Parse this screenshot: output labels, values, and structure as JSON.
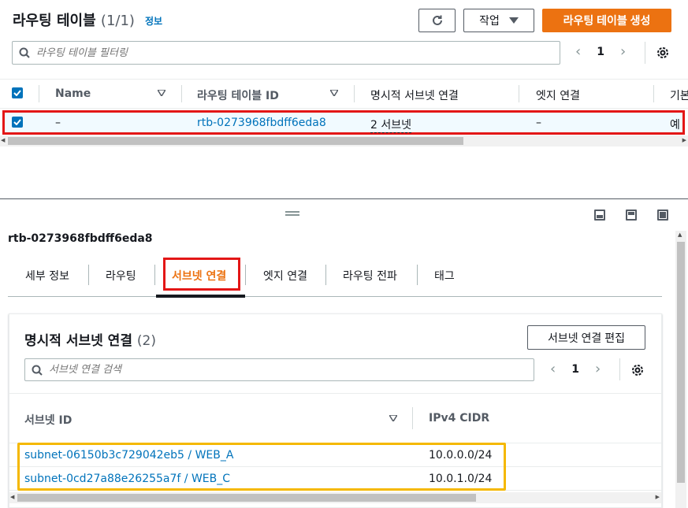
{
  "header": {
    "title": "라우팅 테이블",
    "count": "(1/1)",
    "info_link": "정보",
    "actions_label": "작업",
    "create_label": "라우팅 테이블 생성",
    "filter_placeholder": "라우팅 테이블 필터링",
    "page": "1"
  },
  "route_table": {
    "columns": [
      "Name",
      "라우팅 테이블 ID",
      "명시적 서브넷 연결",
      "엣지 연결",
      "기본"
    ],
    "row": {
      "name": "–",
      "id": "rtb-0273968fbdff6eda8",
      "explicit_subnets": "2 서브넷",
      "edge": "–",
      "main": "예"
    }
  },
  "details": {
    "selected_id": "rtb-0273968fbdff6eda8",
    "tabs": [
      "세부 정보",
      "라우팅",
      "서브넷 연결",
      "엣지 연결",
      "라우팅 전파",
      "태그"
    ],
    "active_tab": "서브넷 연결",
    "section_title": "명시적 서브넷 연결",
    "section_count": "(2)",
    "edit_label": "서브넷 연결 편집",
    "search_placeholder": "서브넷 연결 검색",
    "page": "1",
    "columns": [
      "서브넷 ID",
      "IPv4 CIDR"
    ],
    "rows": [
      {
        "subnet": "subnet-06150b3c729042eb5 / WEB_A",
        "cidr": "10.0.0.0/24"
      },
      {
        "subnet": "subnet-0cd27a88e26255a7f / WEB_C",
        "cidr": "10.0.1.0/24"
      }
    ]
  },
  "icons": {
    "refresh": "refresh-icon",
    "caret": "caret-down-icon",
    "search": "search-icon",
    "settings": "gear-icon",
    "sort": "sort-icon",
    "check": "check-icon"
  },
  "colors": {
    "primary": "#ec7211",
    "link": "#0073bb",
    "highlight_red": "#e31616",
    "highlight_yellow": "#f5b800"
  }
}
